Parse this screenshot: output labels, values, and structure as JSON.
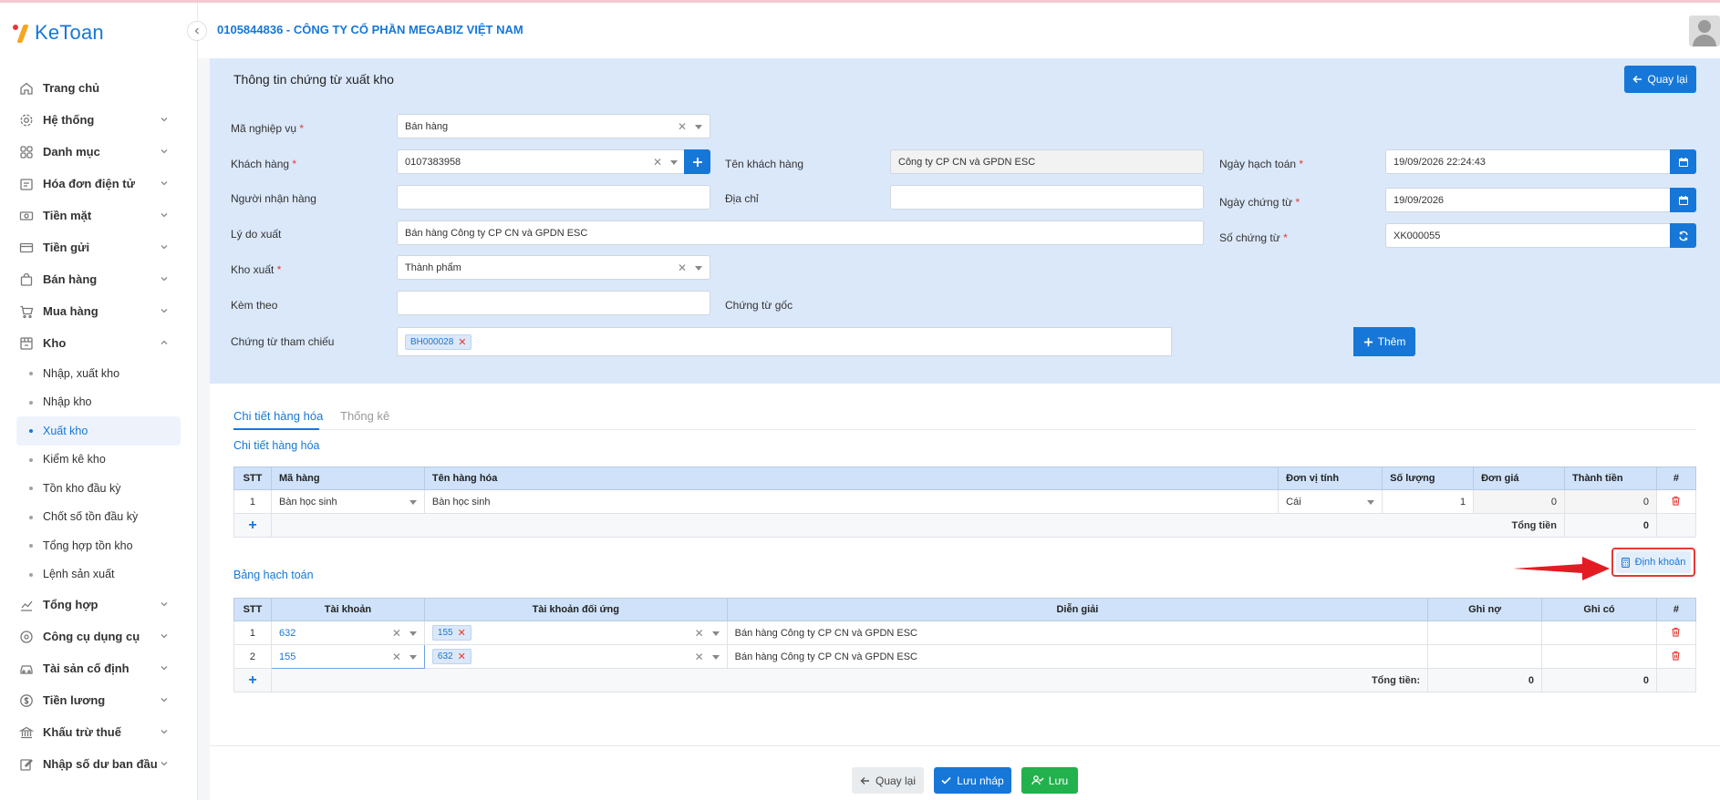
{
  "app": {
    "logo": "KeToan",
    "company": "0105844836 - CÔNG TY CỔ PHẦN MEGABIZ VIỆT NAM"
  },
  "sidebar": {
    "items": [
      {
        "label": "Trang chủ",
        "icon": "home-icon"
      },
      {
        "label": "Hệ thống",
        "icon": "gear-icon"
      },
      {
        "label": "Danh mục",
        "icon": "grid-icon"
      },
      {
        "label": "Hóa đơn điện tử",
        "icon": "invoice-icon"
      },
      {
        "label": "Tiền mặt",
        "icon": "cash-icon"
      },
      {
        "label": "Tiền gửi",
        "icon": "bank-card-icon"
      },
      {
        "label": "Bán hàng",
        "icon": "shopping-bag-icon"
      },
      {
        "label": "Mua hàng",
        "icon": "cart-icon"
      },
      {
        "label": "Kho",
        "icon": "warehouse-icon"
      }
    ],
    "kho_sub": [
      "Nhập, xuất kho",
      "Nhập kho",
      "Xuất kho",
      "Kiểm kê kho",
      "Tồn kho đầu kỳ",
      "Chốt số tồn đầu kỳ",
      "Tổng hợp tồn kho",
      "Lệnh sản xuất"
    ],
    "items_after": [
      {
        "label": "Tổng hợp",
        "icon": "chart-line-icon"
      },
      {
        "label": "Công cụ dụng cụ",
        "icon": "tools-icon"
      },
      {
        "label": "Tài sản cố định",
        "icon": "car-icon"
      },
      {
        "label": "Tiền lương",
        "icon": "dollar-icon"
      },
      {
        "label": "Khấu trừ thuế",
        "icon": "tax-icon"
      },
      {
        "label": "Nhập số dư ban đầu",
        "icon": "edit-icon"
      }
    ]
  },
  "form": {
    "title": "Thông tin chứng từ xuất kho",
    "back_label": "Quay lại",
    "ma_nghiep_vu_label": "Mã nghiệp vụ",
    "ma_nghiep_vu_value": "Bán hàng",
    "khach_hang_label": "Khách hàng",
    "khach_hang_value": "0107383958",
    "ten_khach_hang_label": "Tên khách hàng",
    "ten_khach_hang_value": "Công ty CP CN và GPDN ESC",
    "ngay_hach_toan_label": "Ngày hạch toán",
    "ngay_hach_toan_value": "19/09/2026 22:24:43",
    "nguoi_nhan_label": "Người nhận hàng",
    "nguoi_nhan_value": "",
    "dia_chi_label": "Địa chỉ",
    "dia_chi_value": "",
    "ngay_chung_tu_label": "Ngày chứng từ",
    "ngay_chung_tu_value": "19/09/2026",
    "ly_do_label": "Lý do xuất",
    "ly_do_value": "Bán hàng Công ty CP CN và GPDN ESC",
    "so_chung_tu_label": "Số chứng từ",
    "so_chung_tu_value": "XK000055",
    "kho_xuat_label": "Kho xuất",
    "kho_xuat_value": "Thành phẩm",
    "kem_theo_label": "Kèm theo",
    "kem_theo_value": "",
    "chung_tu_goc_label": "Chứng từ gốc",
    "chung_tu_tham_chieu_label": "Chứng từ tham chiếu",
    "chung_tu_tham_chieu_tag": "BH000028",
    "them_label": "Thêm"
  },
  "tabs": [
    "Chi tiết hàng hóa",
    "Thống kê"
  ],
  "goods": {
    "section_title": "Chi tiết hàng hóa",
    "headers": [
      "STT",
      "Mã hàng",
      "Tên hàng hóa",
      "Đơn vị tính",
      "Số lượng",
      "Đơn giá",
      "Thành tiền",
      "#"
    ],
    "rows": [
      {
        "stt": "1",
        "ma_hang": "Bàn học sinh",
        "ten": "Bàn học sinh",
        "dvt": "Cái",
        "so_luong": "1",
        "don_gia": "0",
        "thanh_tien": "0"
      }
    ],
    "total_label": "Tổng tiền",
    "total_value": "0"
  },
  "accounting": {
    "section_title": "Bảng hạch toán",
    "dinh_khoan_label": "Định khoản",
    "headers": [
      "STT",
      "Tài khoản",
      "Tài khoản đối ứng",
      "Diễn giải",
      "Ghi nợ",
      "Ghi có",
      "#"
    ],
    "rows": [
      {
        "stt": "1",
        "tk": "632",
        "tk_du": "155",
        "dien_giai": "Bán hàng Công ty CP CN và GPDN ESC",
        "no": "",
        "co": ""
      },
      {
        "stt": "2",
        "tk": "155",
        "tk_du": "632",
        "dien_giai": "Bán hàng Công ty CP CN và GPDN ESC",
        "no": "",
        "co": ""
      }
    ],
    "total_label": "Tổng tiền:",
    "total_no": "0",
    "total_co": "0"
  },
  "footer": {
    "back": "Quay lại",
    "save_draft": "Lưu nháp",
    "save": "Lưu"
  },
  "colors": {
    "accent": "#1677d8",
    "danger": "#e53935",
    "success": "#22b14c",
    "panel": "#dbe8fa"
  }
}
